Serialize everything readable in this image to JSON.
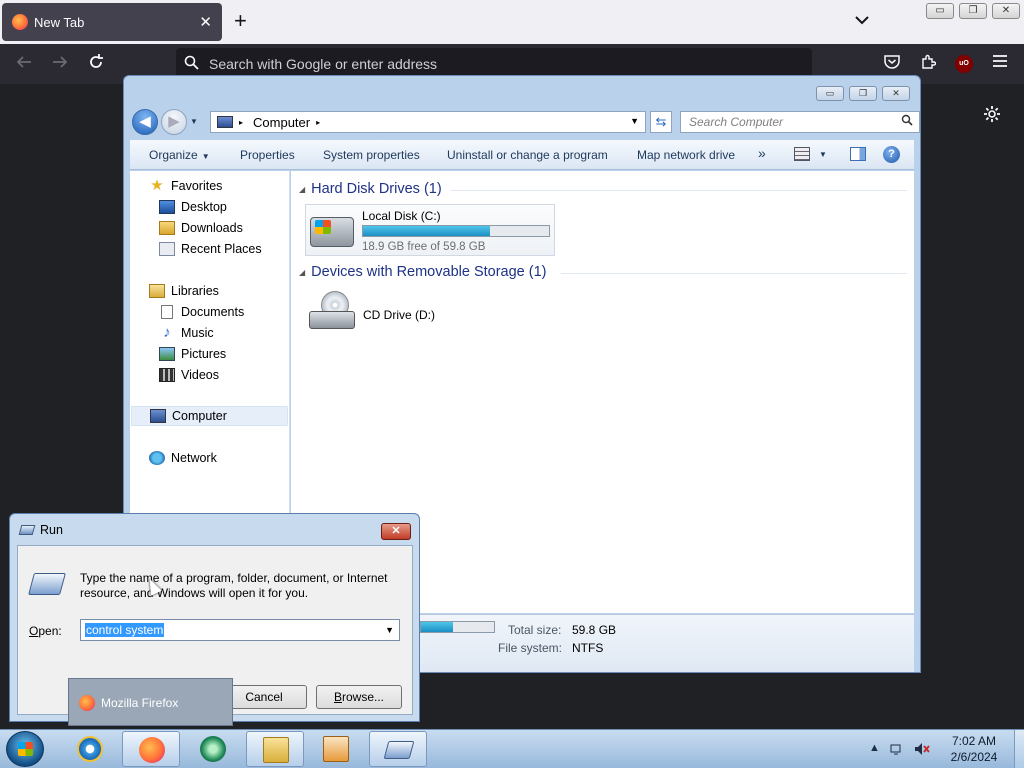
{
  "firefox": {
    "tab_title": "New Tab",
    "tab_close": "✕",
    "new_tab": "+",
    "tabs_menu": "⌄",
    "url_placeholder": "Search with Google or enter address",
    "ublock_badge": "uO"
  },
  "window_controls": {
    "minimize": "▭",
    "restore": "❐",
    "close": "✕"
  },
  "explorer": {
    "address": {
      "root": "Computer",
      "separator": "▸"
    },
    "search_placeholder": "Search Computer",
    "toolbar": {
      "organize": "Organize",
      "properties": "Properties",
      "system_properties": "System properties",
      "uninstall": "Uninstall or change a program",
      "map_drive": "Map network drive",
      "more": "»",
      "help": "?"
    },
    "nav": {
      "favorites": "Favorites",
      "desktop": "Desktop",
      "downloads": "Downloads",
      "recent": "Recent Places",
      "libraries": "Libraries",
      "documents": "Documents",
      "music": "Music",
      "pictures": "Pictures",
      "videos": "Videos",
      "computer": "Computer",
      "network": "Network"
    },
    "groups": {
      "hdd": "Hard Disk Drives (1)",
      "removable": "Devices with Removable Storage (1)"
    },
    "local_disk": {
      "name": "Local Disk (C:)",
      "free_text": "18.9 GB free of 59.8 GB",
      "used_fraction": 0.684
    },
    "cd_drive": {
      "name": "CD Drive (D:)"
    },
    "details": {
      "total_label": "Total size:",
      "total_value": "59.8 GB",
      "fs_label": "File system:",
      "fs_value": "NTFS"
    }
  },
  "run": {
    "title": "Run",
    "close": "✕",
    "description": "Type the name of a program, folder, document, or Internet resource, and Windows will open it for you.",
    "open_label": "Open:",
    "open_value": "control system",
    "cancel": "Cancel",
    "browse": "Browse..."
  },
  "tooltip": {
    "label": "Mozilla Firefox"
  },
  "taskbar": {
    "time": "7:02 AM",
    "date": "2/6/2024"
  },
  "icons": {
    "back": "back-arrow-icon",
    "forward": "forward-arrow-icon",
    "reload": "reload-icon",
    "pocket": "pocket-icon",
    "extensions": "extensions-icon",
    "menu": "hamburger-menu-icon",
    "settings": "gear-icon"
  }
}
